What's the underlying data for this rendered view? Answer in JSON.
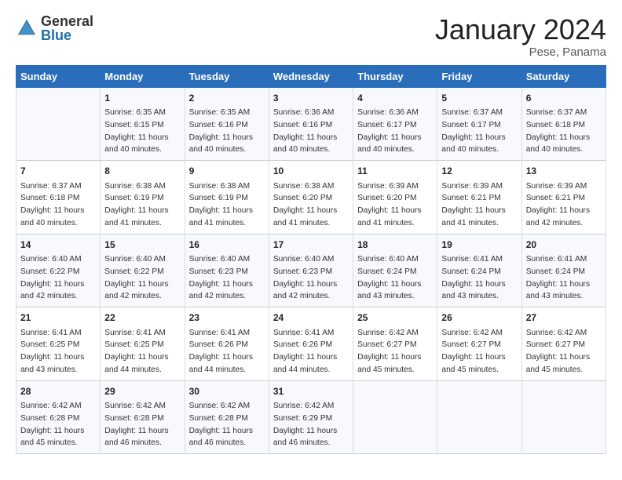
{
  "header": {
    "logo_general": "General",
    "logo_blue": "Blue",
    "month_title": "January 2024",
    "location": "Pese, Panama"
  },
  "days_of_week": [
    "Sunday",
    "Monday",
    "Tuesday",
    "Wednesday",
    "Thursday",
    "Friday",
    "Saturday"
  ],
  "weeks": [
    [
      {
        "day": "",
        "sunrise": "",
        "sunset": "",
        "daylight": ""
      },
      {
        "day": "1",
        "sunrise": "Sunrise: 6:35 AM",
        "sunset": "Sunset: 6:15 PM",
        "daylight": "Daylight: 11 hours and 40 minutes."
      },
      {
        "day": "2",
        "sunrise": "Sunrise: 6:35 AM",
        "sunset": "Sunset: 6:16 PM",
        "daylight": "Daylight: 11 hours and 40 minutes."
      },
      {
        "day": "3",
        "sunrise": "Sunrise: 6:36 AM",
        "sunset": "Sunset: 6:16 PM",
        "daylight": "Daylight: 11 hours and 40 minutes."
      },
      {
        "day": "4",
        "sunrise": "Sunrise: 6:36 AM",
        "sunset": "Sunset: 6:17 PM",
        "daylight": "Daylight: 11 hours and 40 minutes."
      },
      {
        "day": "5",
        "sunrise": "Sunrise: 6:37 AM",
        "sunset": "Sunset: 6:17 PM",
        "daylight": "Daylight: 11 hours and 40 minutes."
      },
      {
        "day": "6",
        "sunrise": "Sunrise: 6:37 AM",
        "sunset": "Sunset: 6:18 PM",
        "daylight": "Daylight: 11 hours and 40 minutes."
      }
    ],
    [
      {
        "day": "7",
        "sunrise": "Sunrise: 6:37 AM",
        "sunset": "Sunset: 6:18 PM",
        "daylight": "Daylight: 11 hours and 40 minutes."
      },
      {
        "day": "8",
        "sunrise": "Sunrise: 6:38 AM",
        "sunset": "Sunset: 6:19 PM",
        "daylight": "Daylight: 11 hours and 41 minutes."
      },
      {
        "day": "9",
        "sunrise": "Sunrise: 6:38 AM",
        "sunset": "Sunset: 6:19 PM",
        "daylight": "Daylight: 11 hours and 41 minutes."
      },
      {
        "day": "10",
        "sunrise": "Sunrise: 6:38 AM",
        "sunset": "Sunset: 6:20 PM",
        "daylight": "Daylight: 11 hours and 41 minutes."
      },
      {
        "day": "11",
        "sunrise": "Sunrise: 6:39 AM",
        "sunset": "Sunset: 6:20 PM",
        "daylight": "Daylight: 11 hours and 41 minutes."
      },
      {
        "day": "12",
        "sunrise": "Sunrise: 6:39 AM",
        "sunset": "Sunset: 6:21 PM",
        "daylight": "Daylight: 11 hours and 41 minutes."
      },
      {
        "day": "13",
        "sunrise": "Sunrise: 6:39 AM",
        "sunset": "Sunset: 6:21 PM",
        "daylight": "Daylight: 11 hours and 42 minutes."
      }
    ],
    [
      {
        "day": "14",
        "sunrise": "Sunrise: 6:40 AM",
        "sunset": "Sunset: 6:22 PM",
        "daylight": "Daylight: 11 hours and 42 minutes."
      },
      {
        "day": "15",
        "sunrise": "Sunrise: 6:40 AM",
        "sunset": "Sunset: 6:22 PM",
        "daylight": "Daylight: 11 hours and 42 minutes."
      },
      {
        "day": "16",
        "sunrise": "Sunrise: 6:40 AM",
        "sunset": "Sunset: 6:23 PM",
        "daylight": "Daylight: 11 hours and 42 minutes."
      },
      {
        "day": "17",
        "sunrise": "Sunrise: 6:40 AM",
        "sunset": "Sunset: 6:23 PM",
        "daylight": "Daylight: 11 hours and 42 minutes."
      },
      {
        "day": "18",
        "sunrise": "Sunrise: 6:40 AM",
        "sunset": "Sunset: 6:24 PM",
        "daylight": "Daylight: 11 hours and 43 minutes."
      },
      {
        "day": "19",
        "sunrise": "Sunrise: 6:41 AM",
        "sunset": "Sunset: 6:24 PM",
        "daylight": "Daylight: 11 hours and 43 minutes."
      },
      {
        "day": "20",
        "sunrise": "Sunrise: 6:41 AM",
        "sunset": "Sunset: 6:24 PM",
        "daylight": "Daylight: 11 hours and 43 minutes."
      }
    ],
    [
      {
        "day": "21",
        "sunrise": "Sunrise: 6:41 AM",
        "sunset": "Sunset: 6:25 PM",
        "daylight": "Daylight: 11 hours and 43 minutes."
      },
      {
        "day": "22",
        "sunrise": "Sunrise: 6:41 AM",
        "sunset": "Sunset: 6:25 PM",
        "daylight": "Daylight: 11 hours and 44 minutes."
      },
      {
        "day": "23",
        "sunrise": "Sunrise: 6:41 AM",
        "sunset": "Sunset: 6:26 PM",
        "daylight": "Daylight: 11 hours and 44 minutes."
      },
      {
        "day": "24",
        "sunrise": "Sunrise: 6:41 AM",
        "sunset": "Sunset: 6:26 PM",
        "daylight": "Daylight: 11 hours and 44 minutes."
      },
      {
        "day": "25",
        "sunrise": "Sunrise: 6:42 AM",
        "sunset": "Sunset: 6:27 PM",
        "daylight": "Daylight: 11 hours and 45 minutes."
      },
      {
        "day": "26",
        "sunrise": "Sunrise: 6:42 AM",
        "sunset": "Sunset: 6:27 PM",
        "daylight": "Daylight: 11 hours and 45 minutes."
      },
      {
        "day": "27",
        "sunrise": "Sunrise: 6:42 AM",
        "sunset": "Sunset: 6:27 PM",
        "daylight": "Daylight: 11 hours and 45 minutes."
      }
    ],
    [
      {
        "day": "28",
        "sunrise": "Sunrise: 6:42 AM",
        "sunset": "Sunset: 6:28 PM",
        "daylight": "Daylight: 11 hours and 45 minutes."
      },
      {
        "day": "29",
        "sunrise": "Sunrise: 6:42 AM",
        "sunset": "Sunset: 6:28 PM",
        "daylight": "Daylight: 11 hours and 46 minutes."
      },
      {
        "day": "30",
        "sunrise": "Sunrise: 6:42 AM",
        "sunset": "Sunset: 6:28 PM",
        "daylight": "Daylight: 11 hours and 46 minutes."
      },
      {
        "day": "31",
        "sunrise": "Sunrise: 6:42 AM",
        "sunset": "Sunset: 6:29 PM",
        "daylight": "Daylight: 11 hours and 46 minutes."
      },
      {
        "day": "",
        "sunrise": "",
        "sunset": "",
        "daylight": ""
      },
      {
        "day": "",
        "sunrise": "",
        "sunset": "",
        "daylight": ""
      },
      {
        "day": "",
        "sunrise": "",
        "sunset": "",
        "daylight": ""
      }
    ]
  ]
}
